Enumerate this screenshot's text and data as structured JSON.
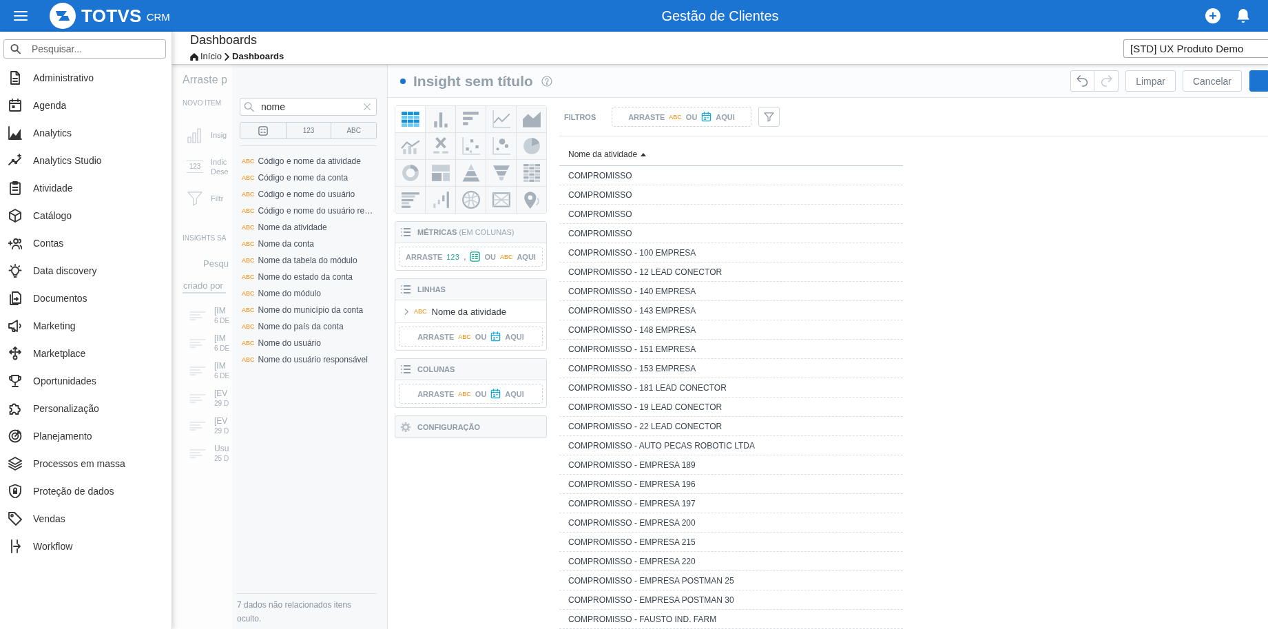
{
  "topbar": {
    "brand": "TOTVS",
    "product": "CRM",
    "title": "Gestão de Clientes"
  },
  "sidebar": {
    "search": {
      "placeholder": "Pesquisar..."
    },
    "items": [
      {
        "label": "Administrativo"
      },
      {
        "label": "Agenda"
      },
      {
        "label": "Analytics"
      },
      {
        "label": "Analytics Studio"
      },
      {
        "label": "Atividade"
      },
      {
        "label": "Catálogo"
      },
      {
        "label": "Contas"
      },
      {
        "label": "Data discovery"
      },
      {
        "label": "Documentos"
      },
      {
        "label": "Marketing"
      },
      {
        "label": "Marketplace"
      },
      {
        "label": "Oportunidades"
      },
      {
        "label": "Personalização"
      },
      {
        "label": "Planejamento"
      },
      {
        "label": "Processos em massa"
      },
      {
        "label": "Proteção de dados"
      },
      {
        "label": "Vendas"
      },
      {
        "label": "Workflow"
      }
    ]
  },
  "page_header": {
    "title": "Dashboards",
    "breadcrumb": [
      {
        "label": "Início"
      },
      {
        "label": "Dashboards"
      }
    ],
    "workspace_select": {
      "value": "[STD] UX Produto Demo"
    }
  },
  "dashboard_panel": {
    "heading": "Arraste p",
    "new_item_label": "NOVO ITEM",
    "new_items": [
      {
        "title": "Insig"
      },
      {
        "badge": "123",
        "title": "Indic",
        "subtitle": "Dese"
      },
      {
        "title": "Filtr"
      }
    ],
    "saved_label": "INSIGHTS SA",
    "search": {
      "placeholder": "Pesqu"
    },
    "tabs": [
      {
        "label": "criado por",
        "selected": true
      }
    ],
    "insights": [
      {
        "title": "[IM",
        "date": "6 DE"
      },
      {
        "title": "[IM",
        "date": "6 DE"
      },
      {
        "title": "[IM",
        "date": "6 DE"
      },
      {
        "title": "[EV",
        "date": "29 D"
      },
      {
        "title": "[EV",
        "date": "29 D"
      },
      {
        "title": "Usu",
        "date": "25 D"
      }
    ]
  },
  "field_picker": {
    "search": {
      "value": "nome"
    },
    "type_filters": [
      {
        "kind": "icon"
      },
      {
        "kind": "label",
        "label": "123"
      },
      {
        "kind": "label",
        "label": "ABC"
      }
    ],
    "fields": [
      {
        "type": "ABC",
        "name": "Código e nome da atividade"
      },
      {
        "type": "ABC",
        "name": "Código e nome da conta"
      },
      {
        "type": "ABC",
        "name": "Código e nome do usuário"
      },
      {
        "type": "ABC",
        "name": "Código e nome do usuário re…"
      },
      {
        "type": "ABC",
        "name": "Nome da atividade"
      },
      {
        "type": "ABC",
        "name": "Nome da conta"
      },
      {
        "type": "ABC",
        "name": "Nome da tabela do módulo"
      },
      {
        "type": "ABC",
        "name": "Nome do estado da conta"
      },
      {
        "type": "ABC",
        "name": "Nome do módulo"
      },
      {
        "type": "ABC",
        "name": "Nome do município da conta"
      },
      {
        "type": "ABC",
        "name": "Nome do país da conta"
      },
      {
        "type": "ABC",
        "name": "Nome do usuário"
      },
      {
        "type": "ABC",
        "name": "Nome do usuário responsável"
      }
    ],
    "footer": "7 dados não relacionados itens oculto."
  },
  "insight": {
    "unsaved": true,
    "title": "Insight sem título",
    "toolbar": {
      "undo": {
        "disabled": false
      },
      "redo": {
        "disabled": true
      },
      "buttons": [
        {
          "kind": "secondary",
          "label": "Limpar"
        },
        {
          "kind": "secondary",
          "label": "Cancelar"
        },
        {
          "kind": "primary"
        }
      ]
    },
    "chart_types": [
      {
        "selected": true
      },
      {
        "selected": false
      },
      {
        "selected": false
      },
      {
        "selected": false
      },
      {
        "selected": false
      },
      {
        "selected": false
      },
      {
        "selected": false
      },
      {
        "selected": false
      },
      {
        "selected": false
      },
      {
        "selected": false
      },
      {
        "selected": false
      },
      {
        "selected": false
      },
      {
        "selected": false
      },
      {
        "selected": false
      },
      {
        "selected": false
      },
      {
        "selected": false
      },
      {
        "selected": false
      },
      {
        "selected": false
      },
      {
        "selected": false
      },
      {
        "selected": false
      }
    ],
    "buckets": [
      {
        "title": "MÉTRICAS",
        "note": "(EM COLUNAS)",
        "drop_zone": [
          {
            "kind": "word",
            "text": "ARRASTE"
          },
          {
            "kind": "number",
            "text": "123"
          },
          {
            "kind": "word",
            "text": ","
          },
          {
            "kind": "attribute"
          },
          {
            "kind": "word",
            "text": "OU"
          },
          {
            "kind": "text",
            "text": "ABC"
          },
          {
            "kind": "word",
            "text": "AQUI"
          }
        ]
      },
      {
        "title": "LINHAS",
        "items": [
          {
            "type": "ABC",
            "name": "Nome da atividade",
            "expanded": false
          }
        ],
        "drop_zone": [
          {
            "kind": "word",
            "text": "ARRASTE"
          },
          {
            "kind": "text",
            "text": "ABC"
          },
          {
            "kind": "word",
            "text": "OU"
          },
          {
            "kind": "date"
          },
          {
            "kind": "word",
            "text": "AQUI"
          }
        ]
      },
      {
        "title": "COLUNAS",
        "drop_zone": [
          {
            "kind": "word",
            "text": "ARRASTE"
          },
          {
            "kind": "text",
            "text": "ABC"
          },
          {
            "kind": "word",
            "text": "OU"
          },
          {
            "kind": "date"
          },
          {
            "kind": "word",
            "text": "AQUI"
          }
        ]
      }
    ],
    "settings": {
      "label": "CONFIGURAÇÃO"
    },
    "filters": {
      "label": "FILTROS",
      "drop_zone": [
        {
          "kind": "word",
          "text": "ARRASTE"
        },
        {
          "kind": "text",
          "text": "ABC"
        },
        {
          "kind": "word",
          "text": "OU"
        },
        {
          "kind": "date"
        },
        {
          "kind": "word",
          "text": "AQUI"
        }
      ]
    },
    "table": {
      "columns": [
        {
          "label": "Nome da atividade",
          "sorted_ascending": true
        }
      ],
      "rows": [
        [
          "COMPROMISSO"
        ],
        [
          "COMPROMISSO"
        ],
        [
          "COMPROMISSO"
        ],
        [
          "COMPROMISSO"
        ],
        [
          "COMPROMISSO - 100 EMPRESA"
        ],
        [
          "COMPROMISSO - 12 LEAD CONECTOR"
        ],
        [
          "COMPROMISSO - 140 EMPRESA"
        ],
        [
          "COMPROMISSO - 143 EMPRESA"
        ],
        [
          "COMPROMISSO - 148 EMPRESA"
        ],
        [
          "COMPROMISSO - 151 EMPRESA"
        ],
        [
          "COMPROMISSO - 153 EMPRESA"
        ],
        [
          "COMPROMISSO - 181 LEAD CONECTOR"
        ],
        [
          "COMPROMISSO - 19 LEAD CONECTOR"
        ],
        [
          "COMPROMISSO - 22 LEAD CONECTOR"
        ],
        [
          "COMPROMISSO - AUTO PECAS ROBOTIC LTDA"
        ],
        [
          "COMPROMISSO - EMPRESA 189"
        ],
        [
          "COMPROMISSO - EMPRESA 196"
        ],
        [
          "COMPROMISSO - EMPRESA 197"
        ],
        [
          "COMPROMISSO - EMPRESA 200"
        ],
        [
          "COMPROMISSO - EMPRESA 215"
        ],
        [
          "COMPROMISSO - EMPRESA 220"
        ],
        [
          "COMPROMISSO - EMPRESA POSTMAN 25"
        ],
        [
          "COMPROMISSO - EMPRESA POSTMAN 30"
        ],
        [
          "COMPROMISSO - FAUSTO IND. FARM"
        ]
      ]
    }
  }
}
